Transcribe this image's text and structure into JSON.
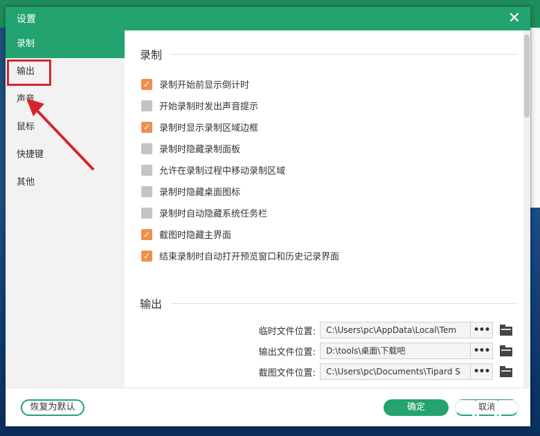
{
  "dialog": {
    "title": "设置",
    "close_symbol": "✕"
  },
  "sidebar": {
    "items": [
      {
        "label": "录制",
        "active": true
      },
      {
        "label": "输出",
        "active": false
      },
      {
        "label": "声音",
        "active": false
      },
      {
        "label": "鼠标",
        "active": false
      },
      {
        "label": "快捷键",
        "active": false
      },
      {
        "label": "其他",
        "active": false
      }
    ]
  },
  "record_section": {
    "title": "录制",
    "options": [
      {
        "label": "录制开始前显示倒计时",
        "checked": true
      },
      {
        "label": "开始录制时发出声音提示",
        "checked": false
      },
      {
        "label": "录制时显示录制区域边框",
        "checked": true
      },
      {
        "label": "录制时隐藏录制面板",
        "checked": false
      },
      {
        "label": "允许在录制过程中移动录制区域",
        "checked": false
      },
      {
        "label": "录制时隐藏桌面图标",
        "checked": false
      },
      {
        "label": "录制时自动隐藏系统任务栏",
        "checked": false
      },
      {
        "label": "截图时隐藏主界面",
        "checked": true
      },
      {
        "label": "结束录制时自动打开预览窗口和历史记录界面",
        "checked": true
      }
    ]
  },
  "output_section": {
    "title": "输出",
    "paths": [
      {
        "label": "临时文件位置:",
        "value": "C:\\Users\\pc\\AppData\\Local\\Tem"
      },
      {
        "label": "输出文件位置:",
        "value": "D:\\tools\\桌面\\下载吧"
      },
      {
        "label": "截图文件位置:",
        "value": "C:\\Users\\pc\\Documents\\Tipard S"
      }
    ],
    "browse_label": "•••"
  },
  "footer": {
    "reset_label": "恢复为默认",
    "ok_label": "确定",
    "cancel_label": "取消"
  },
  "colors": {
    "accent": "#22a36f",
    "checkbox_on": "#f08e4e",
    "checkbox_off": "#c4c4c4",
    "annotation": "#d9232e"
  }
}
